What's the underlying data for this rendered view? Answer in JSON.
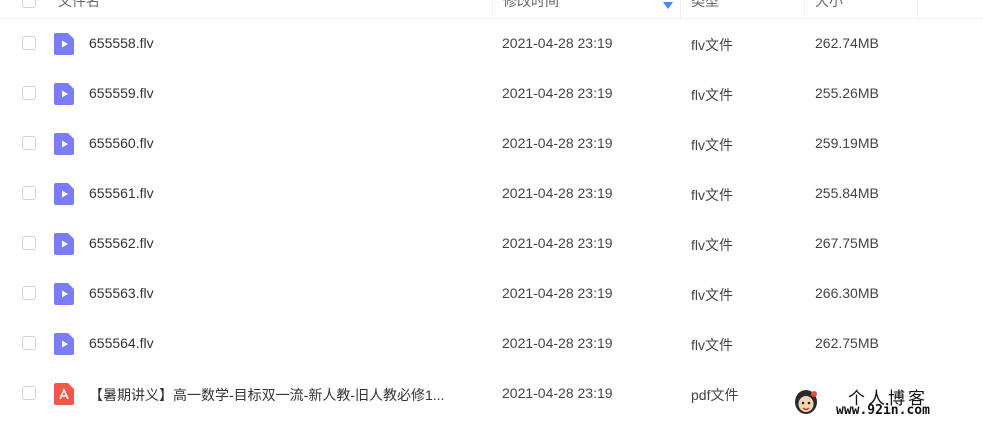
{
  "header": {
    "name_label": "文件名",
    "modified_label": "修改时间",
    "type_label": "类型",
    "size_label": "大小"
  },
  "rows": [
    {
      "name": "655558.flv",
      "modified": "2021-04-28 23:19",
      "type": "flv文件",
      "size": "262.74MB",
      "icon": "video-file-icon"
    },
    {
      "name": "655559.flv",
      "modified": "2021-04-28 23:19",
      "type": "flv文件",
      "size": "255.26MB",
      "icon": "video-file-icon"
    },
    {
      "name": "655560.flv",
      "modified": "2021-04-28 23:19",
      "type": "flv文件",
      "size": "259.19MB",
      "icon": "video-file-icon"
    },
    {
      "name": "655561.flv",
      "modified": "2021-04-28 23:19",
      "type": "flv文件",
      "size": "255.84MB",
      "icon": "video-file-icon"
    },
    {
      "name": "655562.flv",
      "modified": "2021-04-28 23:19",
      "type": "flv文件",
      "size": "267.75MB",
      "icon": "video-file-icon"
    },
    {
      "name": "655563.flv",
      "modified": "2021-04-28 23:19",
      "type": "flv文件",
      "size": "266.30MB",
      "icon": "video-file-icon"
    },
    {
      "name": "655564.flv",
      "modified": "2021-04-28 23:19",
      "type": "flv文件",
      "size": "262.75MB",
      "icon": "video-file-icon"
    },
    {
      "name": "【暑期讲义】高一数学-目标双一流-新人教-旧人教必修1...",
      "modified": "2021-04-28 23:19",
      "type": "pdf文件",
      "size": "",
      "icon": "pdf-file-icon"
    }
  ],
  "watermark": {
    "title": "个人博客",
    "url": "www.92in.com"
  },
  "colors": {
    "video_icon": "#7b7cf7",
    "pdf_icon": "#f1584c",
    "sort_accent": "#3b8cff"
  }
}
